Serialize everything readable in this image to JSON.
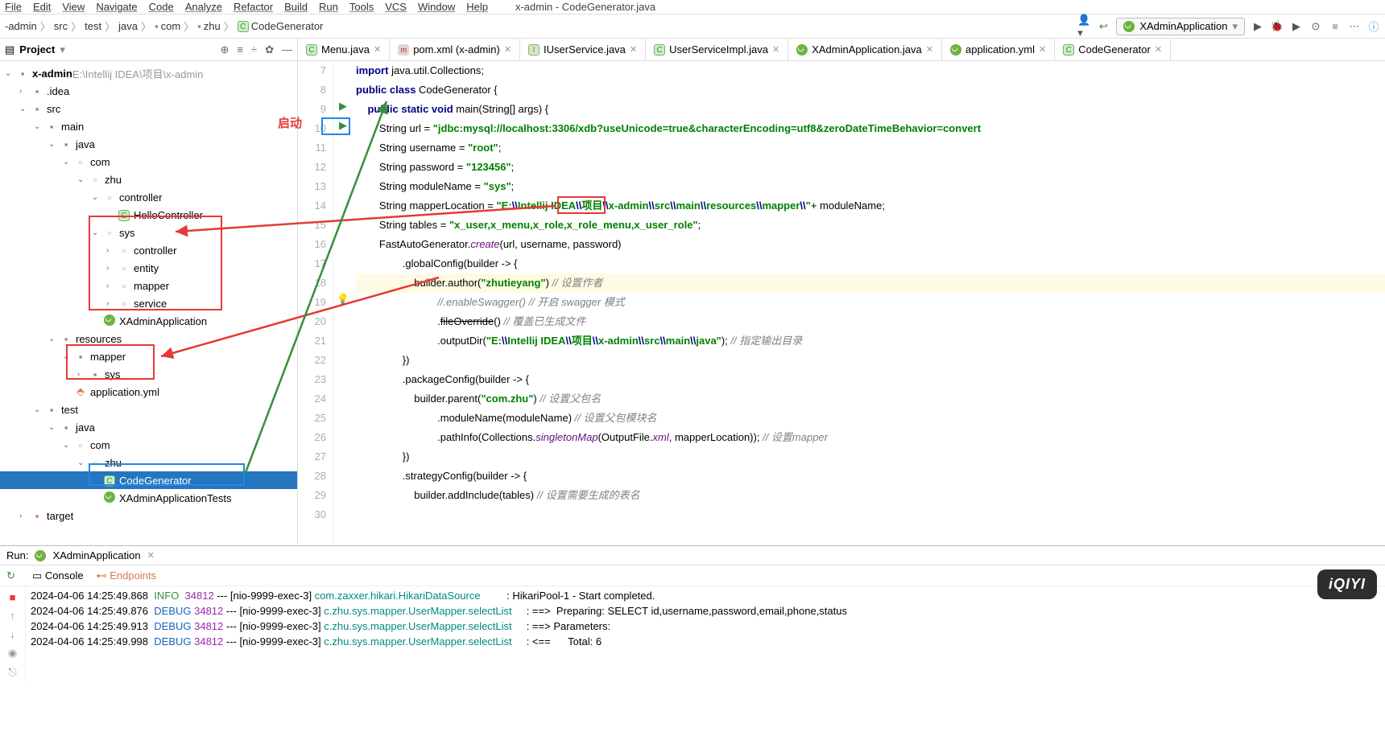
{
  "menubar": {
    "items": [
      "File",
      "Edit",
      "View",
      "Navigate",
      "Code",
      "Analyze",
      "Refactor",
      "Build",
      "Run",
      "Tools",
      "VCS",
      "Window",
      "Help"
    ],
    "title": "x-admin - CodeGenerator.java"
  },
  "breadcrumb": [
    "-admin",
    "src",
    "test",
    "java",
    "com",
    "zhu",
    "CodeGenerator"
  ],
  "runconfig": "XAdminApplication",
  "panel": {
    "title": "Project"
  },
  "tree": {
    "root": {
      "name": "x-admin",
      "path": "E:\\Intellij IDEA\\项目\\x-admin"
    },
    "items": [
      {
        "depth": 1,
        "arrow": "›",
        "kind": "folder",
        "label": ".idea"
      },
      {
        "depth": 1,
        "arrow": "⌄",
        "kind": "folder",
        "label": "src"
      },
      {
        "depth": 2,
        "arrow": "⌄",
        "kind": "folder",
        "label": "main"
      },
      {
        "depth": 3,
        "arrow": "⌄",
        "kind": "folder",
        "label": "java"
      },
      {
        "depth": 4,
        "arrow": "⌄",
        "kind": "pkg",
        "label": "com"
      },
      {
        "depth": 5,
        "arrow": "⌄",
        "kind": "pkg",
        "label": "zhu"
      },
      {
        "depth": 6,
        "arrow": "⌄",
        "kind": "pkg",
        "label": "controller"
      },
      {
        "depth": 7,
        "arrow": "",
        "kind": "class",
        "label": "HelloController"
      },
      {
        "depth": 6,
        "arrow": "⌄",
        "kind": "pkg",
        "label": "sys"
      },
      {
        "depth": 7,
        "arrow": "›",
        "kind": "pkg",
        "label": "controller"
      },
      {
        "depth": 7,
        "arrow": "›",
        "kind": "pkg",
        "label": "entity"
      },
      {
        "depth": 7,
        "arrow": "›",
        "kind": "pkg",
        "label": "mapper"
      },
      {
        "depth": 7,
        "arrow": "›",
        "kind": "pkg",
        "label": "service"
      },
      {
        "depth": 6,
        "arrow": "",
        "kind": "spring",
        "label": "XAdminApplication"
      },
      {
        "depth": 3,
        "arrow": "⌄",
        "kind": "folder",
        "label": "resources"
      },
      {
        "depth": 4,
        "arrow": "⌄",
        "kind": "folder",
        "label": "mapper"
      },
      {
        "depth": 5,
        "arrow": "›",
        "kind": "folder",
        "label": "sys"
      },
      {
        "depth": 4,
        "arrow": "",
        "kind": "yaml",
        "label": "application.yml"
      },
      {
        "depth": 2,
        "arrow": "⌄",
        "kind": "folder",
        "label": "test"
      },
      {
        "depth": 3,
        "arrow": "⌄",
        "kind": "folder",
        "label": "java"
      },
      {
        "depth": 4,
        "arrow": "⌄",
        "kind": "pkg",
        "label": "com"
      },
      {
        "depth": 5,
        "arrow": "⌄",
        "kind": "pkg",
        "label": "zhu"
      },
      {
        "depth": 6,
        "arrow": "",
        "kind": "class",
        "label": "CodeGenerator",
        "selected": true
      },
      {
        "depth": 6,
        "arrow": "",
        "kind": "spring",
        "label": "XAdminApplicationTests"
      },
      {
        "depth": 1,
        "arrow": "›",
        "kind": "folder-orange",
        "label": "target"
      }
    ]
  },
  "tabs": [
    {
      "icon": "c",
      "label": "Menu.java"
    },
    {
      "icon": "m",
      "label": "pom.xml (x-admin)"
    },
    {
      "icon": "i",
      "label": "IUserService.java"
    },
    {
      "icon": "c",
      "label": "UserServiceImpl.java"
    },
    {
      "icon": "spring",
      "label": "XAdminApplication.java"
    },
    {
      "icon": "spring",
      "label": "application.yml"
    },
    {
      "icon": "c",
      "label": "CodeGenerator"
    }
  ],
  "code": {
    "line_start": 7,
    "lines": [
      {
        "n": 7,
        "html": "<span class='kw'>import</span> java.util.Collections;"
      },
      {
        "n": 8,
        "html": ""
      },
      {
        "n": 9,
        "icon": "run",
        "html": "<span class='kw'>public class</span> CodeGenerator {"
      },
      {
        "n": 10,
        "icon": "run",
        "html": "    <span class='kw'>public static void</span> main(String[] args) {"
      },
      {
        "n": 11,
        "html": "        String url = <span class='str'>\"jdbc:mysql://localhost:3306/xdb?useUnicode=true&characterEncoding=utf8&zeroDateTimeBehavior=convert</span>"
      },
      {
        "n": 12,
        "html": "        String username = <span class='str'>\"root\"</span>;"
      },
      {
        "n": 13,
        "html": "        String password = <span class='str'>\"123456\"</span>;"
      },
      {
        "n": 14,
        "html": "        String moduleName = <span class='str'>\"sys\"</span>;"
      },
      {
        "n": 15,
        "html": "        String mapperLocation = <span class='str'>\"E:<span class='kw'>\\\\</span>Intellij IDEA<span class='kw'>\\\\</span>项目<span class='kw'>\\\\</span>x-admin<span class='kw'>\\\\</span>src<span class='kw'>\\\\</span>main<span class='kw'>\\\\</span>resources<span class='kw'>\\\\</span>mapper<span class='kw'>\\\\</span>\"</span>+ moduleName;"
      },
      {
        "n": 16,
        "html": "        String tables = <span class='str'>\"x_user,x_menu,x_role,x_role_menu,x_user_role\"</span>;"
      },
      {
        "n": 17,
        "html": "        FastAutoGenerator.<span class='field'>create</span>(url, username, password)"
      },
      {
        "n": 18,
        "html": "                .globalConfig(builder -> {"
      },
      {
        "n": 19,
        "icon": "bulb",
        "hl": true,
        "html": "                    builder.author(<span class='str'>\"zhutieyang\"</span>) <span class='comment'>// 设置作者</span>"
      },
      {
        "n": 20,
        "html": "                            <span class='comment'>//.enableSwagger() // 开启 swagger 模式</span>"
      },
      {
        "n": 21,
        "html": "                            .<span class='strike'>fileOverride</span>() <span class='comment'>// 覆盖已生成文件</span>"
      },
      {
        "n": 22,
        "html": "                            .outputDir(<span class='str'>\"E:<span class='kw'>\\\\</span>Intellij IDEA<span class='kw'>\\\\</span>项目<span class='kw'>\\\\</span>x-admin<span class='kw'>\\\\</span>src<span class='kw'>\\\\</span>main<span class='kw'>\\\\</span>java\"</span>); <span class='comment'>// 指定输出目录</span>"
      },
      {
        "n": 23,
        "html": "                })"
      },
      {
        "n": 24,
        "html": "                .packageConfig(builder -> {"
      },
      {
        "n": 25,
        "html": "                    builder.parent(<span class='str'>\"com.zhu\"</span>) <span class='comment'>// 设置父包名</span>"
      },
      {
        "n": 26,
        "html": "                            .moduleName(moduleName) <span class='comment'>// 设置父包模块名</span>"
      },
      {
        "n": 27,
        "html": "                            .pathInfo(Collections.<span class='field'>singletonMap</span>(OutputFile.<span class='field'>xml</span>, mapperLocation)); <span class='comment'>// 设置mapper</span>"
      },
      {
        "n": 28,
        "html": "                })"
      },
      {
        "n": 29,
        "html": "                .strategyConfig(builder -> {"
      },
      {
        "n": 30,
        "html": "                    builder.addInclude(tables) <span class='comment'>// 设置需要生成的表名</span>"
      }
    ]
  },
  "run": {
    "title": "Run:",
    "tab": "XAdminApplication",
    "subtabs": [
      "Console",
      "Endpoints"
    ],
    "lines": [
      {
        "t": "2024-04-06 14:25:49.868",
        "lvl": "INFO",
        "pid": "34812",
        "thr": "[nio-9999-exec-3]",
        "logger": "com.zaxxer.hikari.HikariDataSource",
        "msg": ": HikariPool-1 - Start completed."
      },
      {
        "t": "2024-04-06 14:25:49.876",
        "lvl": "DEBUG",
        "pid": "34812",
        "thr": "[nio-9999-exec-3]",
        "logger": "c.zhu.sys.mapper.UserMapper.selectList",
        "msg": ": ==>  Preparing: SELECT id,username,password,email,phone,status"
      },
      {
        "t": "2024-04-06 14:25:49.913",
        "lvl": "DEBUG",
        "pid": "34812",
        "thr": "[nio-9999-exec-3]",
        "logger": "c.zhu.sys.mapper.UserMapper.selectList",
        "msg": ": ==> Parameters:"
      },
      {
        "t": "2024-04-06 14:25:49.998",
        "lvl": "DEBUG",
        "pid": "34812",
        "thr": "[nio-9999-exec-3]",
        "logger": "c.zhu.sys.mapper.UserMapper.selectList",
        "msg": ": <==      Total: 6"
      }
    ]
  },
  "annotations": {
    "launch_label": "启动"
  }
}
